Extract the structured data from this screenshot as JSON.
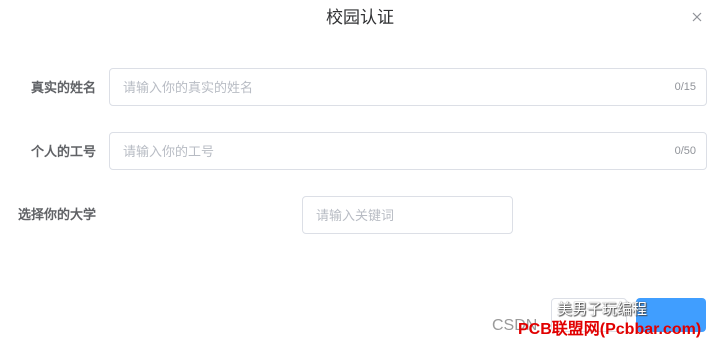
{
  "dialog": {
    "title": "校园认证",
    "close_icon": "close-icon"
  },
  "form": {
    "name": {
      "label": "真实的姓名",
      "placeholder": "请输入你的真实的姓名",
      "value": "",
      "count": "0/15"
    },
    "job_number": {
      "label": "个人的工号",
      "placeholder": "请输入你的工号",
      "value": "",
      "count": "0/50"
    },
    "university": {
      "label": "选择你的大学",
      "placeholder": "请输入关键词",
      "value": ""
    }
  },
  "footer": {
    "cancel_label": "",
    "confirm_label": ""
  },
  "watermarks": {
    "csdn": "CSDN",
    "author": "美男子玩编程",
    "pcb": "PCB联盟网(Pcbbar.com)"
  },
  "colors": {
    "primary": "#409eff",
    "border": "#dcdfe6",
    "label": "#606266",
    "placeholder": "#b8bcc4",
    "watermark_red": "#e10000"
  }
}
